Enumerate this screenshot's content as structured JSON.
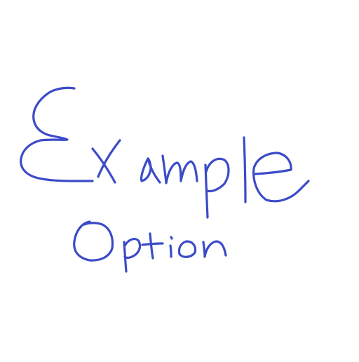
{
  "drawing": {
    "ink_color": "#3b4bc8",
    "words": [
      "Example",
      "Option"
    ]
  }
}
